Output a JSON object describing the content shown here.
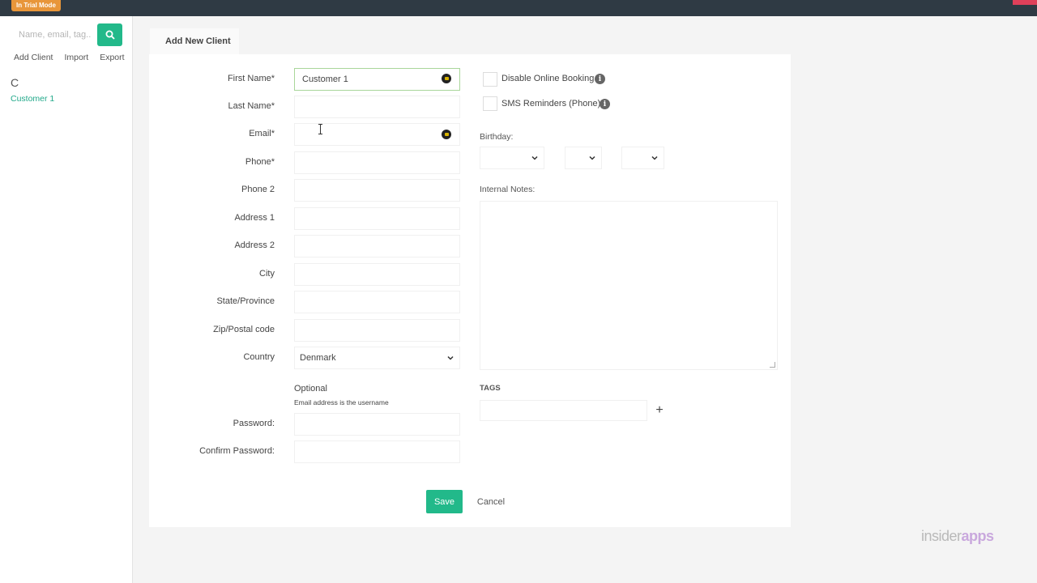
{
  "topbar": {
    "trial_badge": "In Trial Mode"
  },
  "sidebar": {
    "search_placeholder": "Name, email, tag..",
    "links": {
      "add_client": "Add Client",
      "import": "Import",
      "export": "Export"
    },
    "group_letter": "C",
    "clients": [
      "Customer 1"
    ]
  },
  "tab": {
    "label": "Add New Client"
  },
  "form": {
    "first_name": {
      "label": "First Name*",
      "value": "Customer 1"
    },
    "last_name": {
      "label": "Last Name*",
      "value": ""
    },
    "email": {
      "label": "Email*",
      "value": ""
    },
    "phone": {
      "label": "Phone*",
      "value": ""
    },
    "phone2": {
      "label": "Phone 2",
      "value": ""
    },
    "address1": {
      "label": "Address 1",
      "value": ""
    },
    "address2": {
      "label": "Address 2",
      "value": ""
    },
    "city": {
      "label": "City",
      "value": ""
    },
    "state": {
      "label": "State/Province",
      "value": ""
    },
    "zip": {
      "label": "Zip/Postal code",
      "value": ""
    },
    "country": {
      "label": "Country",
      "value": "Denmark"
    },
    "optional_heading": "Optional",
    "optional_note": "Email address is the username",
    "password": {
      "label": "Password:",
      "value": ""
    },
    "confirm_password": {
      "label": "Confirm Password:",
      "value": ""
    }
  },
  "options": {
    "disable_online_booking": "Disable Online Booking",
    "sms_reminders": "SMS Reminders (Phone)",
    "birthday_label": "Birthday:",
    "internal_notes_label": "Internal Notes:",
    "tags_label": "TAGS",
    "tags_add": "+"
  },
  "actions": {
    "save": "Save",
    "cancel": "Cancel"
  },
  "brand": {
    "left": "insider",
    "right": "apps"
  },
  "colors": {
    "accent": "#22b98a",
    "topbar": "#2f3a44",
    "trial": "#e8963a"
  }
}
